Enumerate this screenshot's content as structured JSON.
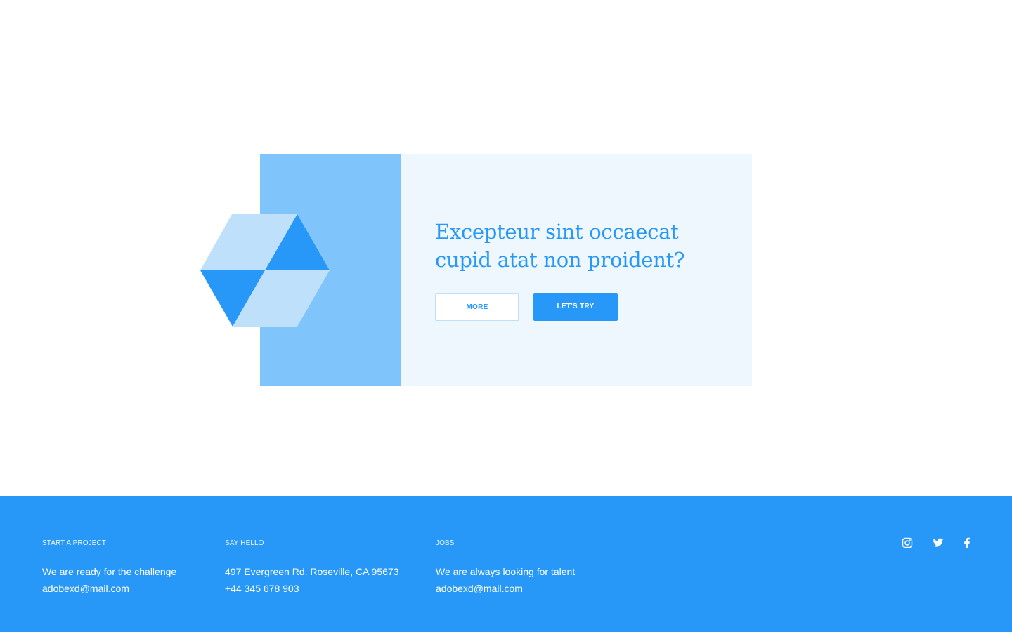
{
  "cta": {
    "heading": "Excepteur sint occaecat cupid atat non proident?",
    "more_label": "MORE",
    "try_label": "LET'S TRY"
  },
  "footer": {
    "columns": [
      {
        "title": "START A PROJECT",
        "lines": [
          "We are ready for the challenge",
          "adobexd@mail.com"
        ]
      },
      {
        "title": "SAY HELLO",
        "lines": [
          "497 Evergreen Rd. Roseville, CA 95673",
          "+44 345 678 903"
        ]
      },
      {
        "title": "JOBS",
        "lines": [
          "We are always looking for talent",
          "adobexd@mail.com"
        ]
      }
    ],
    "social": [
      "instagram-icon",
      "twitter-icon",
      "facebook-icon"
    ]
  },
  "colors": {
    "accent": "#2898f8",
    "light_accent": "#80c4fc",
    "pale_panel": "#eff7fe",
    "cube_light": "#bfe0fb",
    "footer_bg": "#2898f8"
  }
}
